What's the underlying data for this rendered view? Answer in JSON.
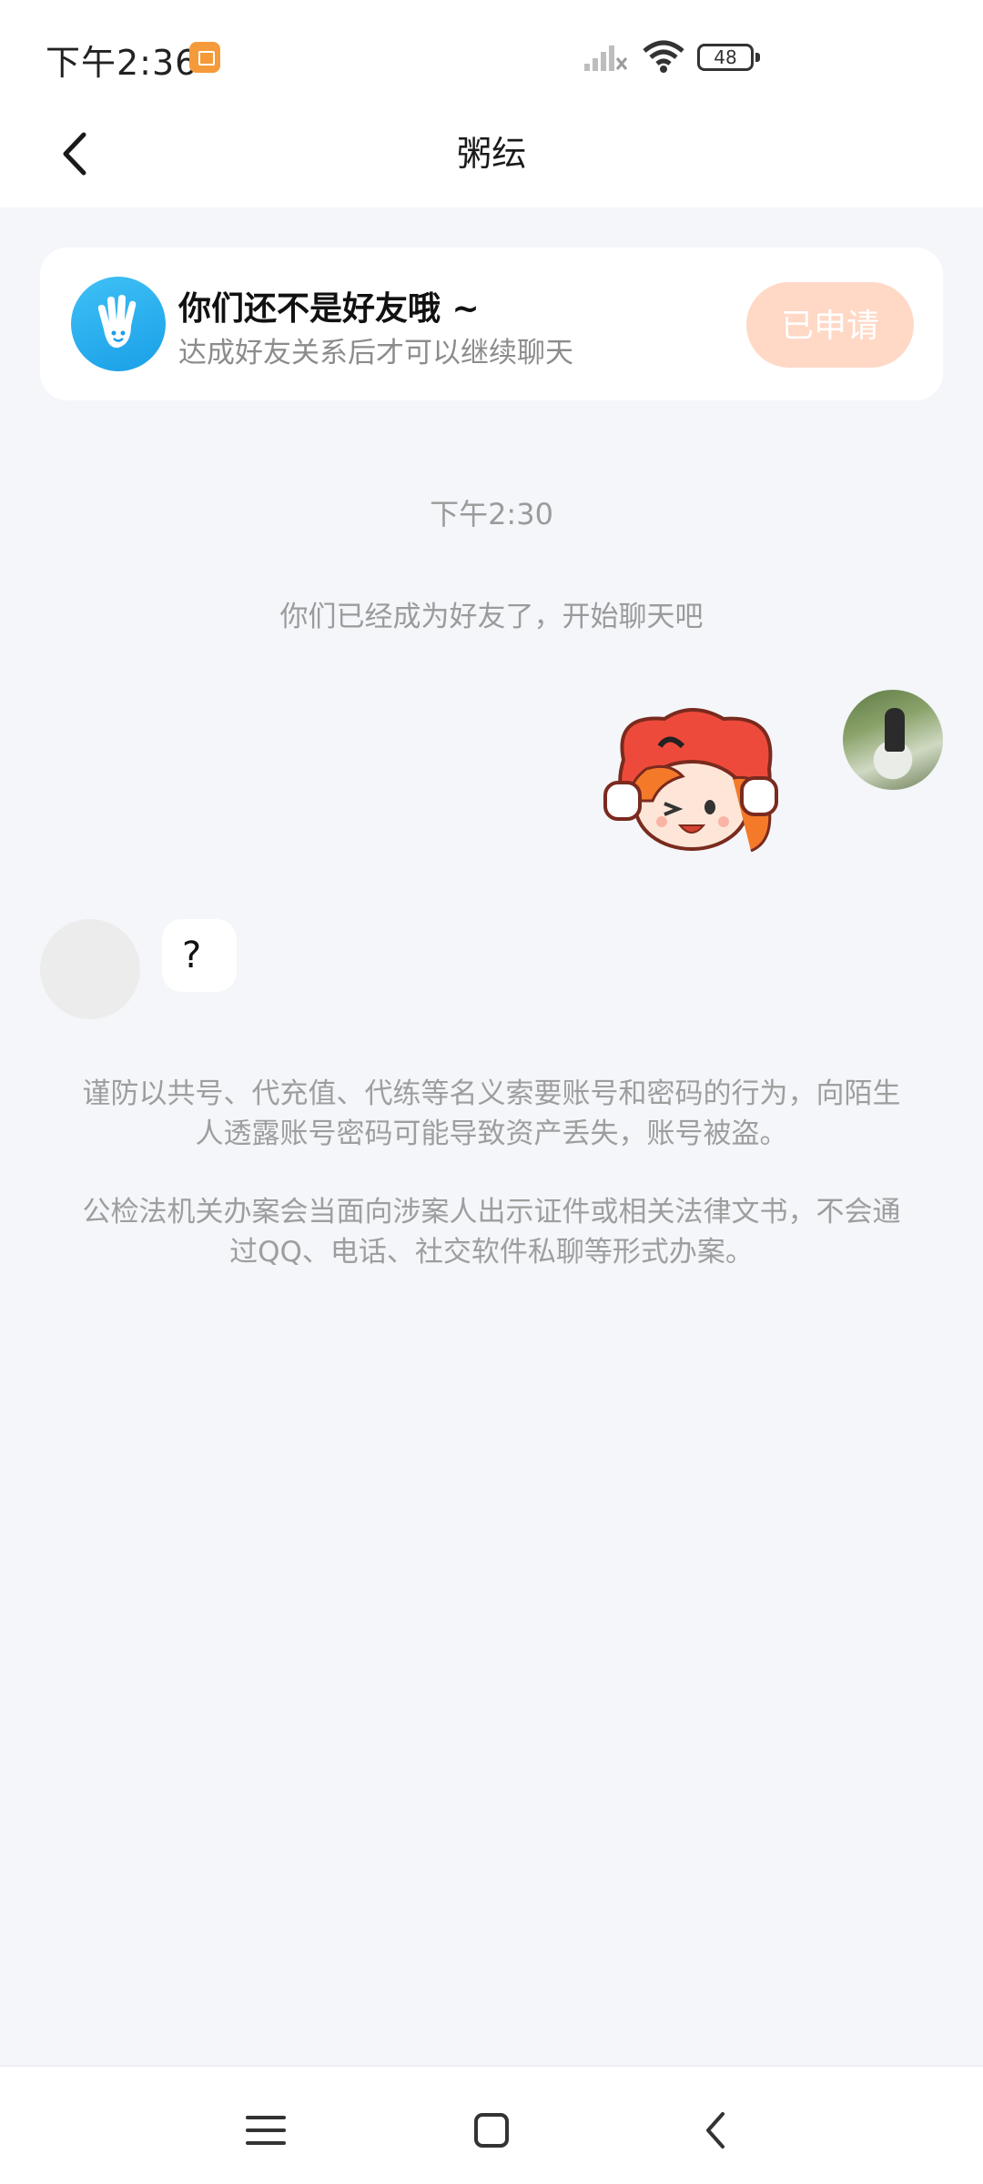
{
  "status_bar": {
    "time": "下午2:36",
    "battery": "48"
  },
  "header": {
    "title": "粥纭"
  },
  "friend_card": {
    "title": "你们还不是好友哦 ~",
    "subtitle": "达成好友关系后才可以继续聊天",
    "button_label": "已申请"
  },
  "chat": {
    "timestamp": "下午2:30",
    "system_message": "你们已经成为好友了，开始聊天吧",
    "incoming_message": "?"
  },
  "notices": [
    "谨防以共号、代充值、代练等名义索要账号和密码的行为，向陌生人透露账号密码可能导致资产丢失，账号被盗。",
    "公检法机关办案会当面向涉案人出示证件或相关法律文书，不会通过QQ、电话、社交软件私聊等形式办案。"
  ],
  "colors": {
    "background": "#f4f6f9",
    "applied_button": "#ffd8c6",
    "friend_icon": "#1a9fe8"
  },
  "icons": {
    "back": "chevron-left-icon",
    "friend": "hand-wave-icon",
    "nav_menu": "menu-icon",
    "nav_home": "home-square-icon",
    "nav_back": "nav-back-icon"
  }
}
